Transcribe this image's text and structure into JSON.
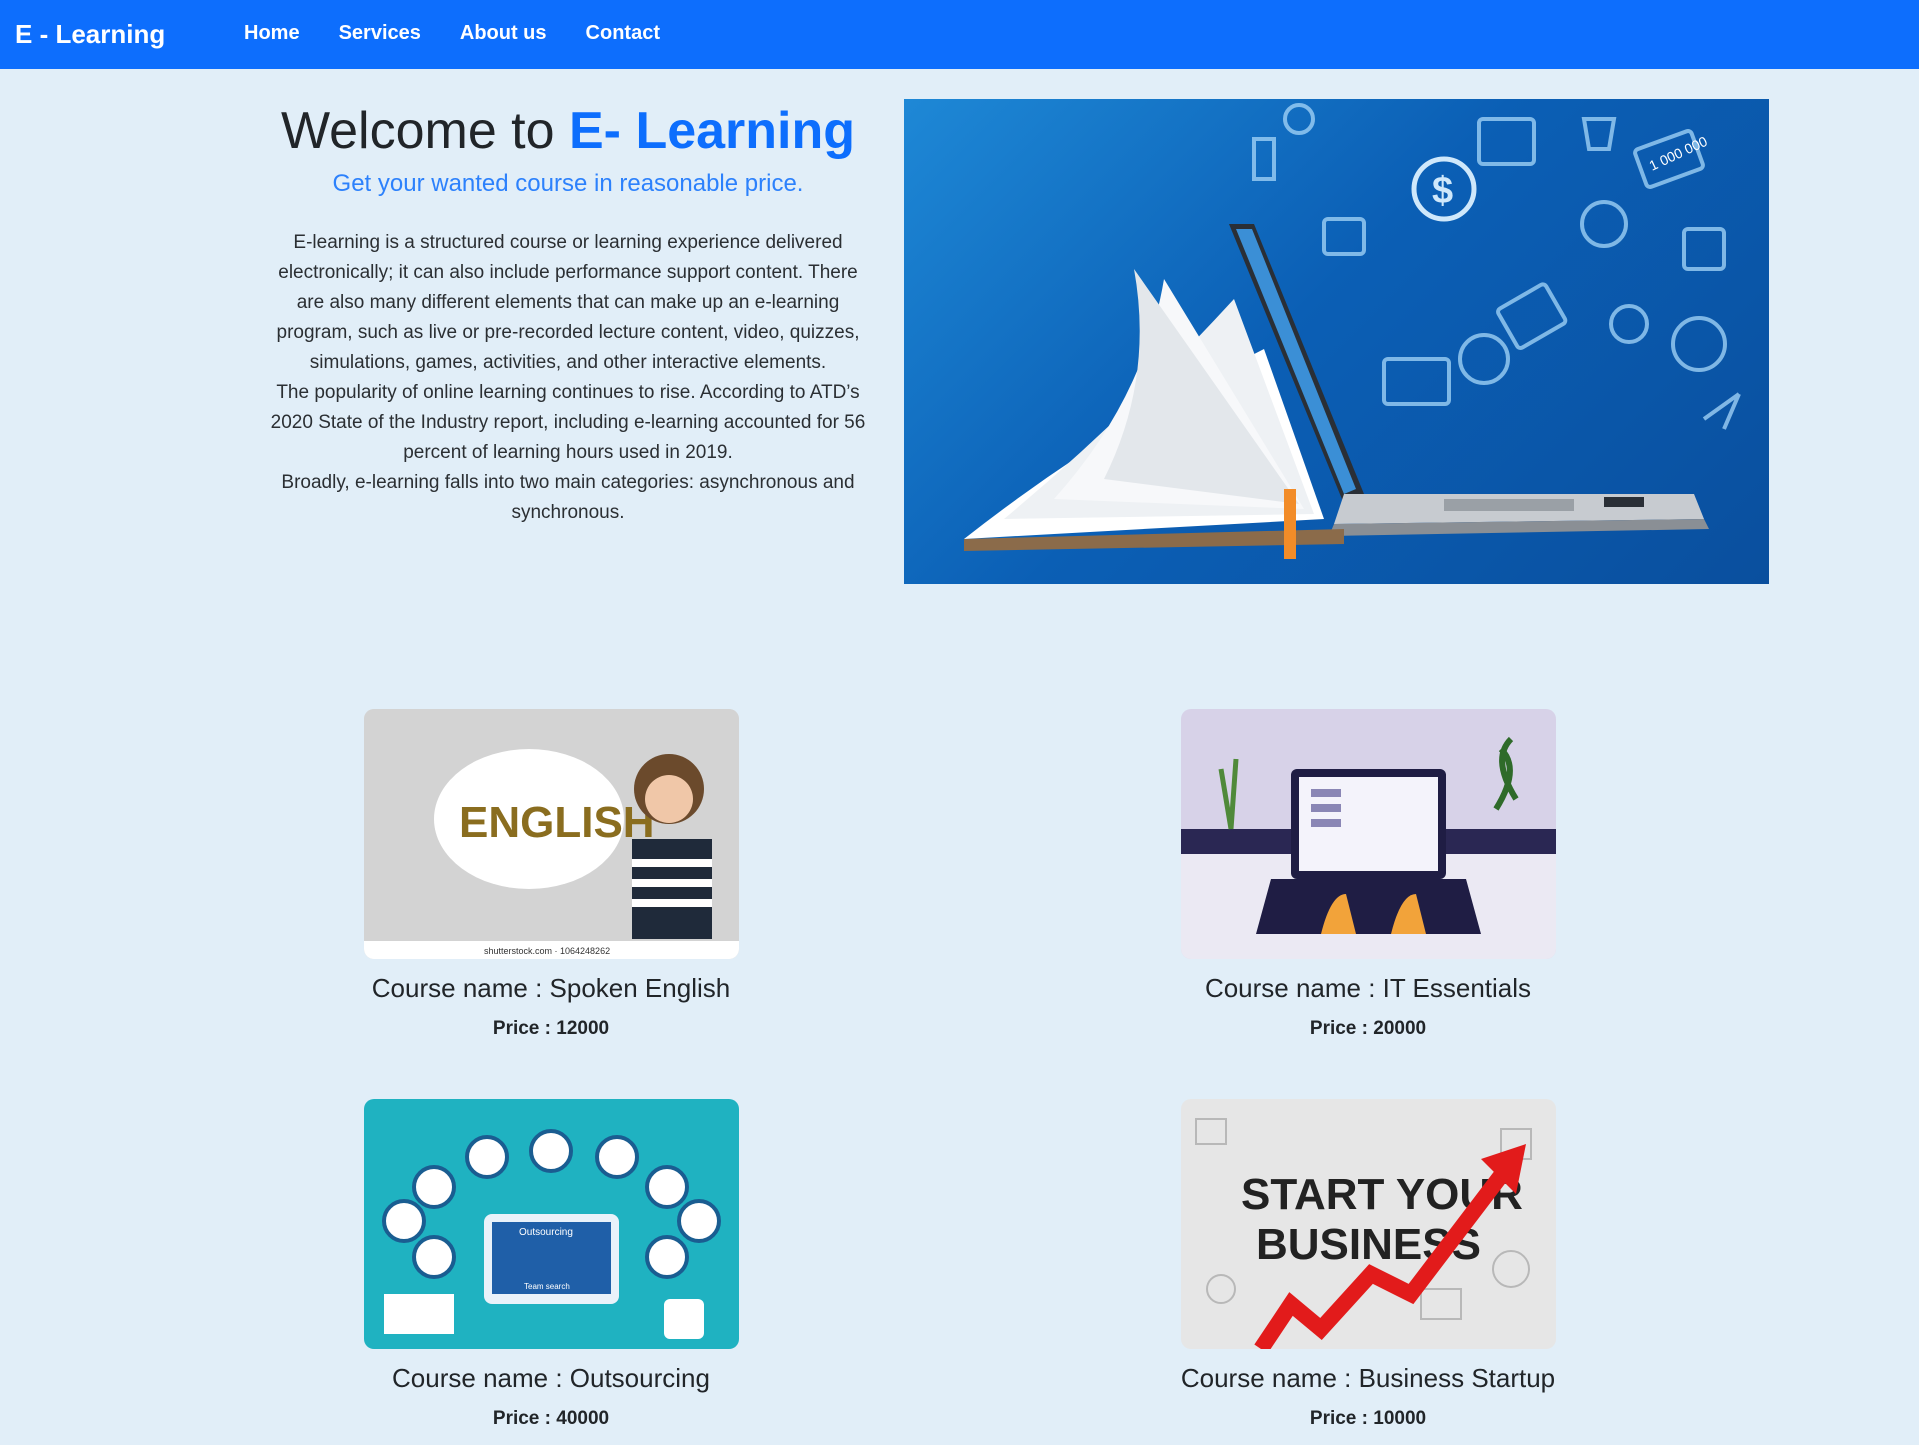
{
  "navbar": {
    "brand": "E - Learning",
    "links": [
      {
        "label": "Home"
      },
      {
        "label": "Services"
      },
      {
        "label": "About us"
      },
      {
        "label": "Contact"
      }
    ]
  },
  "hero": {
    "title_prefix": "Welcome to ",
    "title_accent": "E- Learning",
    "subtitle": "Get your wanted course in reasonable price.",
    "paragraph_1": "E-learning is a structured course or learning experience delivered electronically; it can also include performance support content. There are also many different elements that can make up an e-learning program, such as live or pre-recorded lecture content, video, quizzes, simulations, games, activities, and other interactive elements.",
    "paragraph_2": "The popularity of online learning continues to rise. According to ATD’s 2020 State of the Industry report, including e-learning accounted for 56 percent of learning hours used in 2019.",
    "paragraph_3": "Broadly, e-learning falls into two main categories: asynchronous and synchronous."
  },
  "courses": [
    {
      "name": "Course name : Spoken English",
      "price": "Price : 12000",
      "image_text": "ENGLISH",
      "image_caption": "shutterstock.com · 1064248262"
    },
    {
      "name": "Course name : IT Essentials",
      "price": "Price : 20000"
    },
    {
      "name": "Course name : Outsourcing",
      "price": "Price : 40000",
      "image_text": "Outsourcing",
      "image_caption": "Team search"
    },
    {
      "name": "Course name : Business Startup",
      "price": "Price : 10000",
      "image_text_1": "START YOUR",
      "image_text_2": "BUSINESS"
    }
  ],
  "hero_image_text": "1 000 000"
}
